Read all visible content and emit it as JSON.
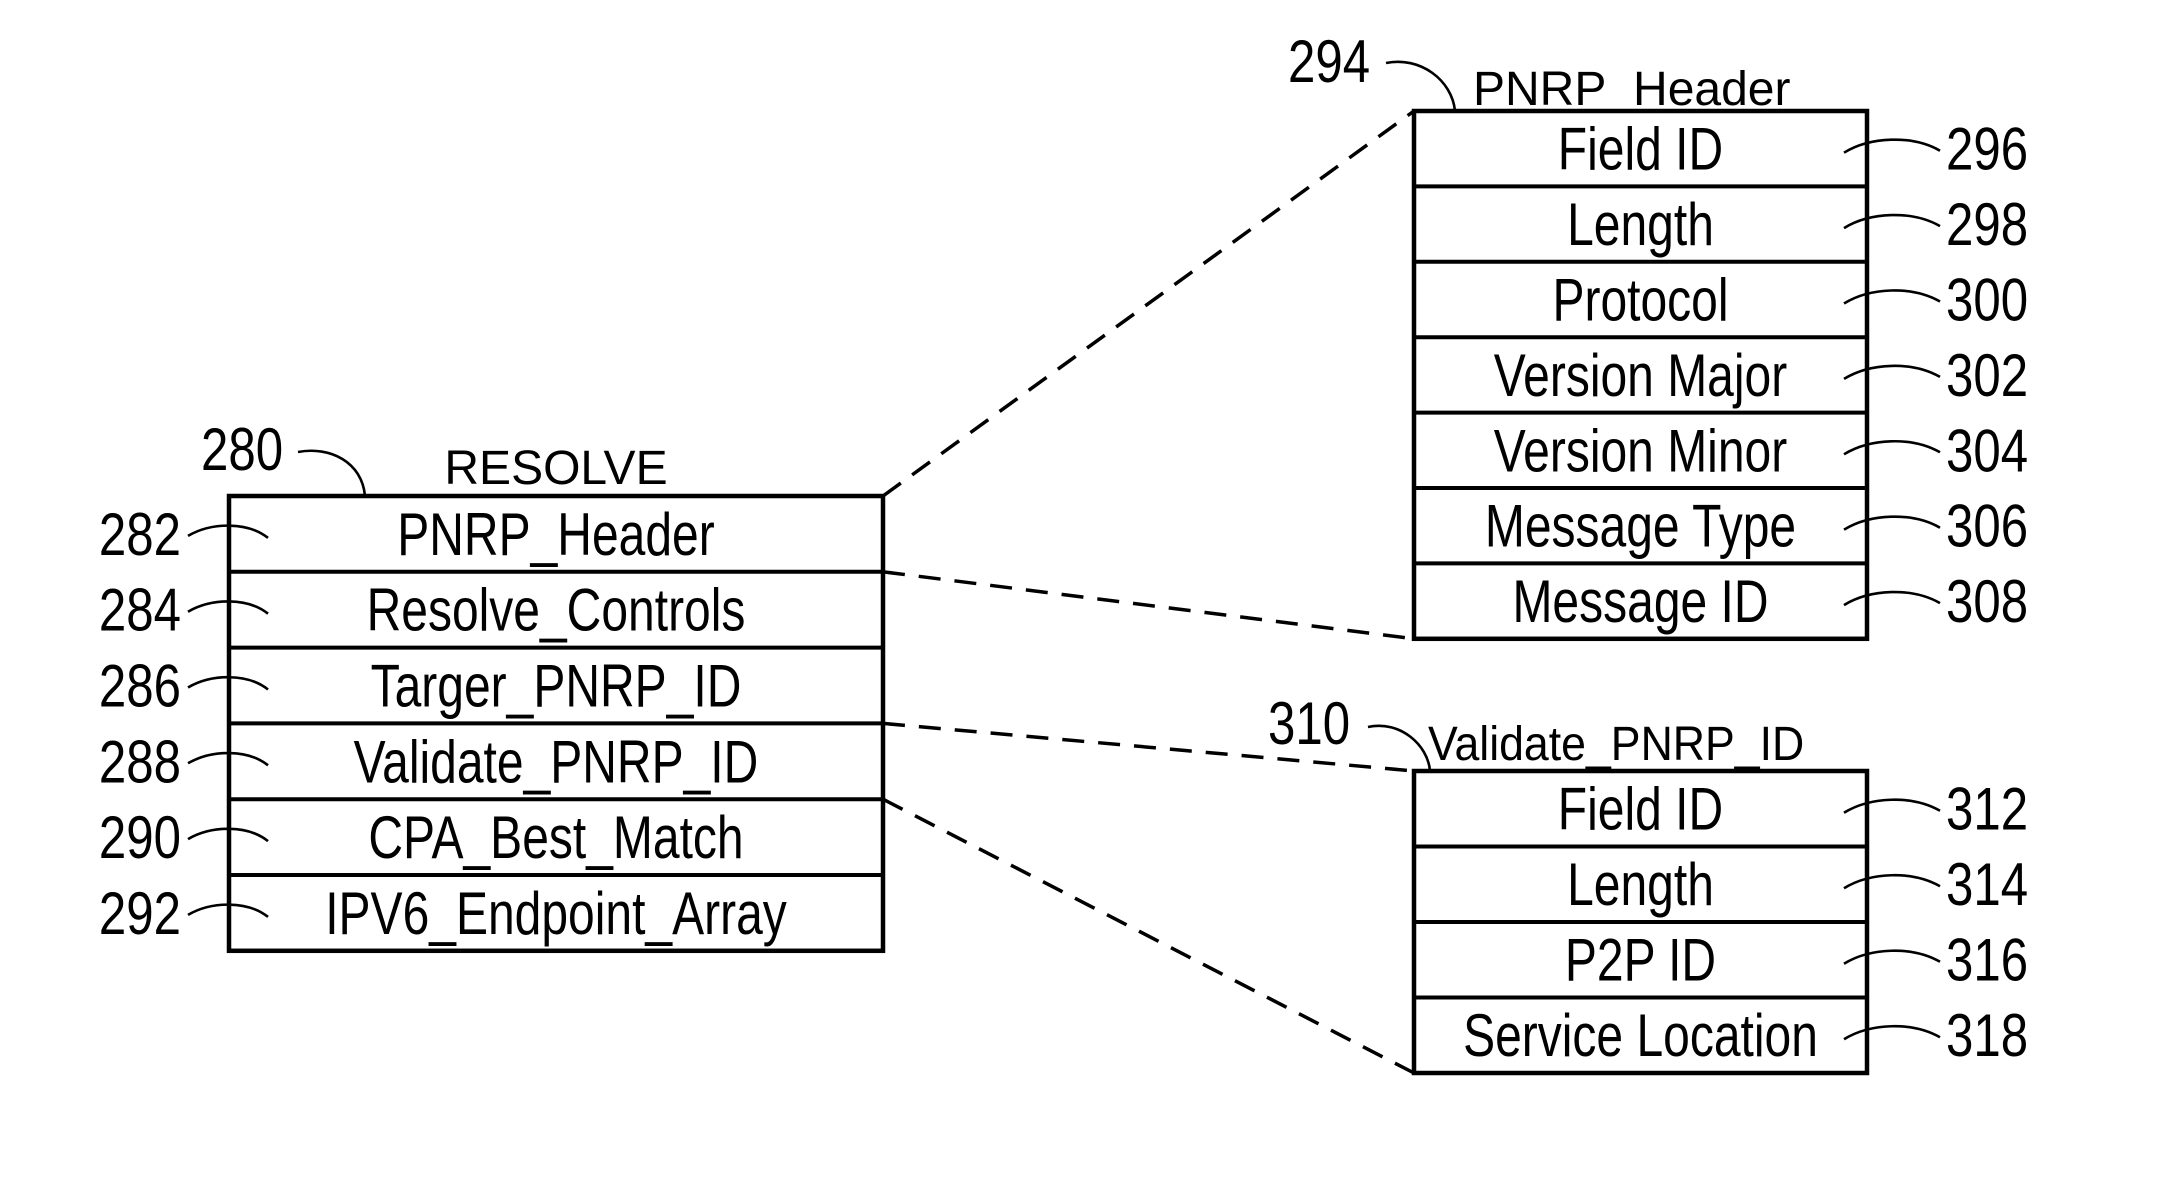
{
  "diagram": {
    "structures": [
      {
        "id": "resolve",
        "ref": "280",
        "title": "RESOLVE",
        "fields": [
          {
            "label": "PNRP_Header",
            "ref": "282"
          },
          {
            "label": "Resolve_Controls",
            "ref": "284"
          },
          {
            "label": "Targer_PNRP_ID",
            "ref": "286"
          },
          {
            "label": "Validate_PNRP_ID",
            "ref": "288"
          },
          {
            "label": "CPA_Best_Match",
            "ref": "290"
          },
          {
            "label": "IPV6_Endpoint_Array",
            "ref": "292"
          }
        ]
      },
      {
        "id": "pnrp-header",
        "ref": "294",
        "title": "PNRP_Header",
        "fields": [
          {
            "label": "Field ID",
            "ref": "296"
          },
          {
            "label": "Length",
            "ref": "298"
          },
          {
            "label": "Protocol",
            "ref": "300"
          },
          {
            "label": "Version Major",
            "ref": "302"
          },
          {
            "label": "Version Minor",
            "ref": "304"
          },
          {
            "label": "Message Type",
            "ref": "306"
          },
          {
            "label": "Message ID",
            "ref": "308"
          }
        ]
      },
      {
        "id": "validate-pnrp-id",
        "ref": "310",
        "title": "Validate_PNRP_ID",
        "fields": [
          {
            "label": "Field ID",
            "ref": "312"
          },
          {
            "label": "Length",
            "ref": "314"
          },
          {
            "label": "P2P ID",
            "ref": "316"
          },
          {
            "label": "Service Location",
            "ref": "318"
          }
        ]
      }
    ],
    "expansions": [
      {
        "from": "resolve",
        "field": "PNRP_Header",
        "to": "pnrp-header"
      },
      {
        "from": "resolve",
        "field": "Validate_PNRP_ID",
        "to": "validate-pnrp-id"
      }
    ],
    "line_color": "#000000",
    "background": "#ffffff"
  }
}
